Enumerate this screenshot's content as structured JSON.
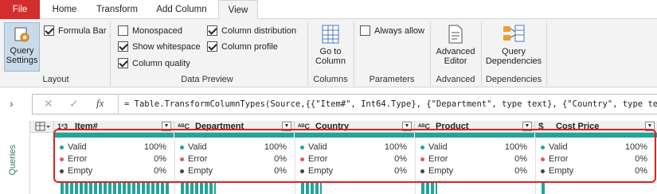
{
  "tabs": [
    {
      "label": "File"
    },
    {
      "label": "Home"
    },
    {
      "label": "Transform"
    },
    {
      "label": "Add Column"
    },
    {
      "label": "View"
    }
  ],
  "ribbon": {
    "query_settings": "Query Settings",
    "formula_bar": "Formula Bar",
    "layout_group": "Layout",
    "monospaced": "Monospaced",
    "show_whitespace": "Show whitespace",
    "column_quality": "Column quality",
    "column_distribution": "Column distribution",
    "column_profile": "Column profile",
    "data_preview_group": "Data Preview",
    "go_to_column": "Go to Column",
    "columns_group": "Columns",
    "always_allow": "Always allow",
    "parameters_group": "Parameters",
    "advanced_editor": "Advanced Editor",
    "advanced_group": "Advanced",
    "query_dependencies": "Query Dependencies",
    "dependencies_group": "Dependencies"
  },
  "checkbox_state": {
    "formula_bar": true,
    "monospaced": false,
    "show_whitespace": true,
    "column_quality": true,
    "column_distribution": true,
    "column_profile": true,
    "always_allow": false
  },
  "formula": {
    "fx": "fx",
    "text": "= Table.TransformColumnTypes(Source,{{\"Item#\", Int64.Type}, {\"Department\", type text}, {\"Country\", type text}"
  },
  "queries_label": "Queries",
  "columns": [
    {
      "type_icon": "1²3",
      "name": "Item#",
      "valid": "100%",
      "error": "0%",
      "empty": "0%"
    },
    {
      "type_icon": "ᴬᴮC",
      "name": "Department",
      "valid": "100%",
      "error": "0%",
      "empty": "0%"
    },
    {
      "type_icon": "ᴬᴮC",
      "name": "Country",
      "valid": "100%",
      "error": "0%",
      "empty": "0%"
    },
    {
      "type_icon": "ᴬᴮC",
      "name": "Product",
      "valid": "100%",
      "error": "0%",
      "empty": "0%"
    },
    {
      "type_icon": "$",
      "name": "Cost Price",
      "valid": "100%",
      "error": "0%",
      "empty": "0%"
    }
  ],
  "stat_labels": {
    "valid": "Valid",
    "error": "Error",
    "empty": "Empty"
  },
  "colors": {
    "valid": "#21a59a",
    "error": "#e05a4f",
    "empty": "#444444",
    "file_tab": "#d32d2d",
    "highlight": "#e02020"
  }
}
